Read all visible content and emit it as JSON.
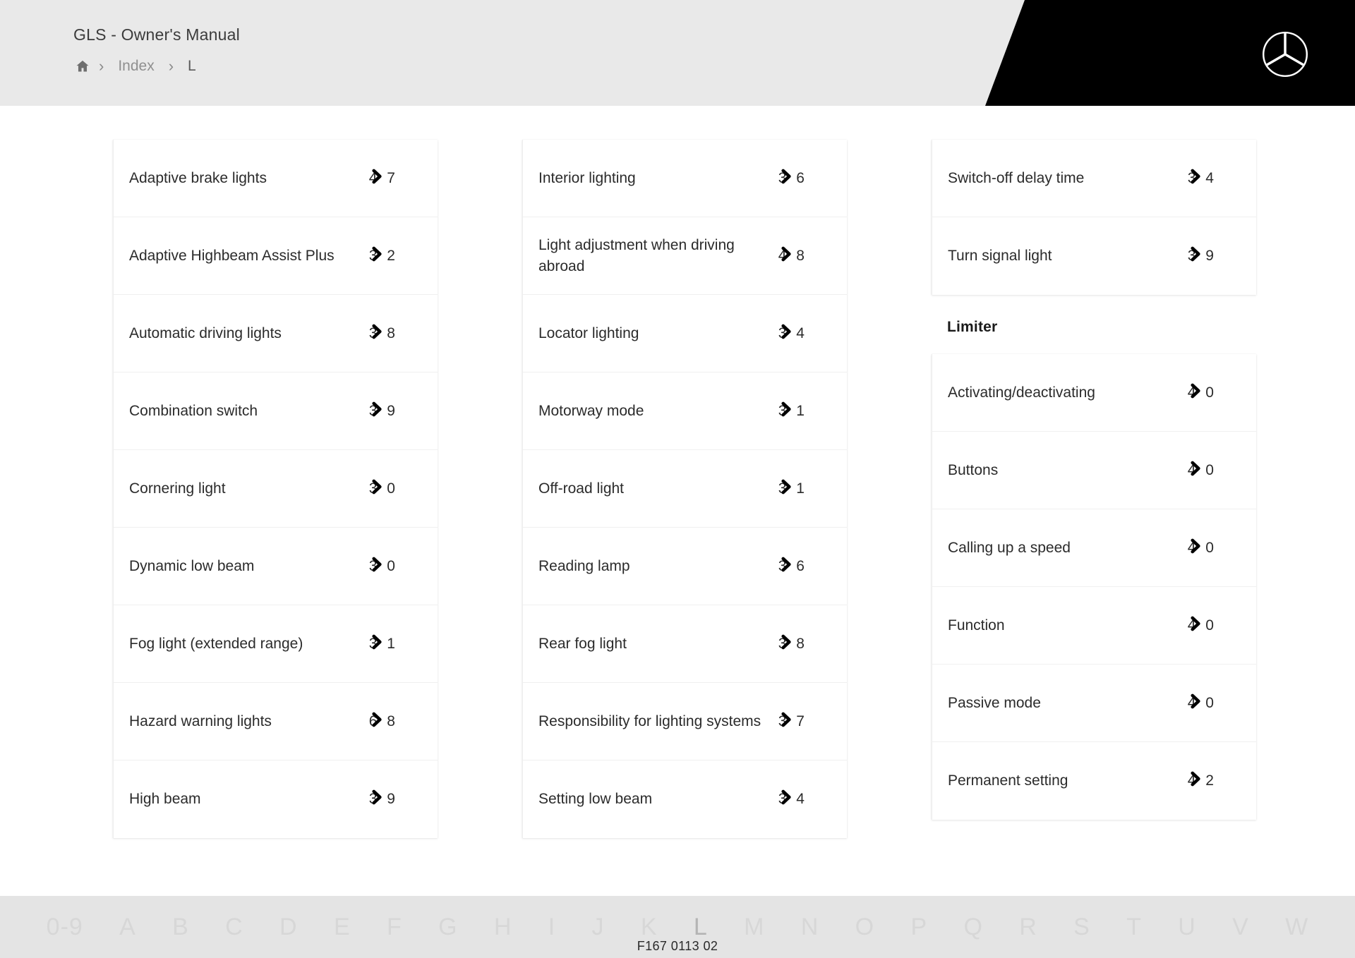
{
  "header": {
    "title": "GLS - Owner's Manual",
    "breadcrumb": {
      "home_icon": "home-icon",
      "separator": "›",
      "items": [
        "Index",
        "L"
      ]
    },
    "logo": "mercedes-benz-star-logo"
  },
  "columns": [
    {
      "sections": [
        {
          "heading": null,
          "rows": [
            {
              "label": "Adaptive brake lights",
              "page": "4 7"
            },
            {
              "label": "Adaptive Highbeam Assist Plus",
              "page": "3 2"
            },
            {
              "label": "Automatic driving lights",
              "page": "3 8"
            },
            {
              "label": "Combination switch",
              "page": "3 9"
            },
            {
              "label": "Cornering light",
              "page": "3 0"
            },
            {
              "label": "Dynamic low beam",
              "page": "3 0"
            },
            {
              "label": "Fog light (extended range)",
              "page": "3 1"
            },
            {
              "label": "Hazard warning lights",
              "page": "6 8"
            },
            {
              "label": "High beam",
              "page": "3 9"
            }
          ]
        }
      ]
    },
    {
      "sections": [
        {
          "heading": null,
          "rows": [
            {
              "label": "Interior lighting",
              "page": "3 6"
            },
            {
              "label": "Light adjustment when driving abroad",
              "page": "4 8"
            },
            {
              "label": "Locator lighting",
              "page": "3 4"
            },
            {
              "label": "Motorway mode",
              "page": "3 1"
            },
            {
              "label": "Off-road light",
              "page": "3 1"
            },
            {
              "label": "Reading lamp",
              "page": "3 6"
            },
            {
              "label": "Rear fog light",
              "page": "3 8"
            },
            {
              "label": "Responsibility for lighting systems",
              "page": "3 7"
            },
            {
              "label": "Setting low beam",
              "page": "3 4"
            }
          ]
        }
      ]
    },
    {
      "sections": [
        {
          "heading": null,
          "rows": [
            {
              "label": "Switch-off delay time",
              "page": "3 4"
            },
            {
              "label": "Turn signal light",
              "page": "3 9"
            }
          ]
        },
        {
          "heading": "Limiter",
          "rows": [
            {
              "label": "Activating/deactivating",
              "page": "4 0"
            },
            {
              "label": "Buttons",
              "page": "4 0"
            },
            {
              "label": "Calling up a speed",
              "page": "4 0"
            },
            {
              "label": "Function",
              "page": "4 0"
            },
            {
              "label": "Passive mode",
              "page": "4 0"
            },
            {
              "label": "Permanent setting",
              "page": "4 2"
            }
          ]
        }
      ]
    }
  ],
  "alphabet_bar": {
    "letters": [
      "0-9",
      "A",
      "B",
      "C",
      "D",
      "E",
      "F",
      "G",
      "H",
      "I",
      "J",
      "K",
      "L",
      "M",
      "N",
      "O",
      "P",
      "Q",
      "R",
      "S",
      "T",
      "U",
      "V",
      "W"
    ],
    "active": "L"
  },
  "document_code": "F167 0113 02",
  "colors": {
    "header_bg": "#e9e9e9",
    "header_accent": "#000000",
    "alpha_bar_bg": "#e4e4e4",
    "text_primary": "#2b2b2b",
    "text_muted": "#8f8f8f"
  }
}
